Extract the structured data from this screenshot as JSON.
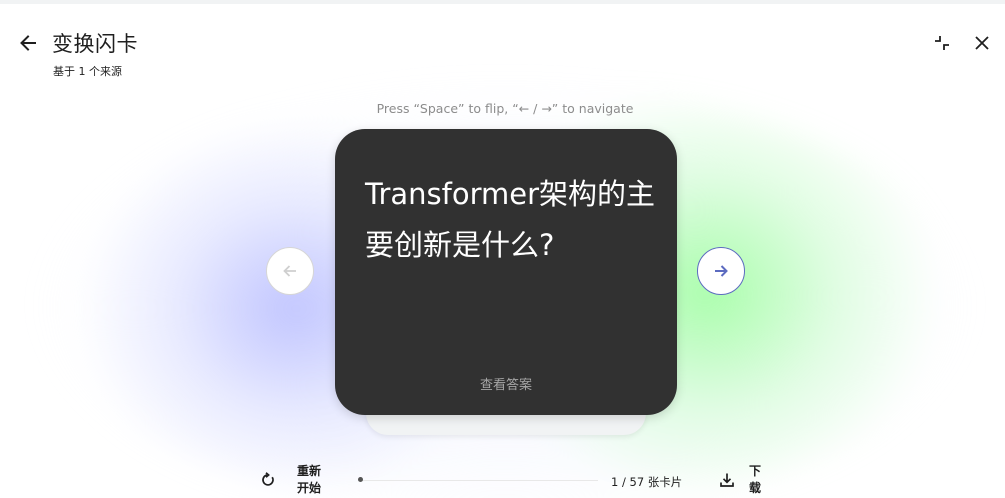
{
  "header": {
    "title": "变换闪卡",
    "subtitle": "基于 1 个来源"
  },
  "hint": "Press “Space” to flip, “← / →” to navigate",
  "card": {
    "question": "Transformer架构的主要创新是什么?",
    "reveal_label": "查看答案"
  },
  "footer": {
    "restart_label": "重新开始",
    "progress_text": "1 / 57 张卡片",
    "progress_fraction": 0.0175,
    "download_label": "下载"
  },
  "colors": {
    "card": "#313131",
    "next_accent": "#5c6bc0",
    "glow_blue": "#afb4ff",
    "glow_green": "#96ff96"
  },
  "icons": [
    "back-arrow-icon",
    "collapse-icon",
    "close-icon",
    "arrow-left-icon",
    "arrow-right-icon",
    "restart-icon",
    "download-icon"
  ]
}
